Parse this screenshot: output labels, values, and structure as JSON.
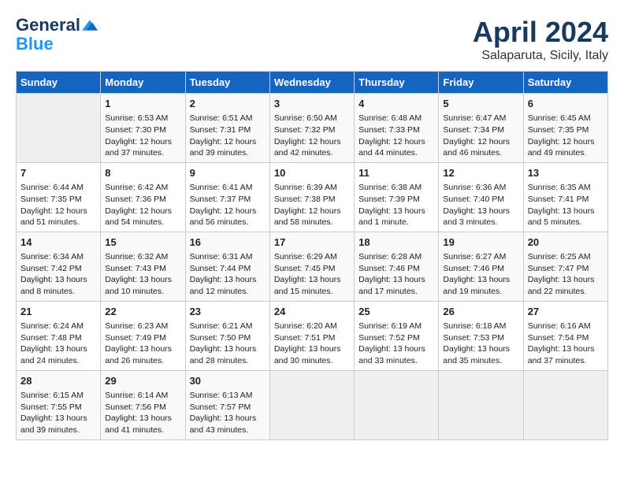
{
  "header": {
    "logo_line1": "General",
    "logo_line2": "Blue",
    "month": "April 2024",
    "location": "Salaparuta, Sicily, Italy"
  },
  "columns": [
    "Sunday",
    "Monday",
    "Tuesday",
    "Wednesday",
    "Thursday",
    "Friday",
    "Saturday"
  ],
  "weeks": [
    [
      {
        "day": "",
        "info": ""
      },
      {
        "day": "1",
        "info": "Sunrise: 6:53 AM\nSunset: 7:30 PM\nDaylight: 12 hours\nand 37 minutes."
      },
      {
        "day": "2",
        "info": "Sunrise: 6:51 AM\nSunset: 7:31 PM\nDaylight: 12 hours\nand 39 minutes."
      },
      {
        "day": "3",
        "info": "Sunrise: 6:50 AM\nSunset: 7:32 PM\nDaylight: 12 hours\nand 42 minutes."
      },
      {
        "day": "4",
        "info": "Sunrise: 6:48 AM\nSunset: 7:33 PM\nDaylight: 12 hours\nand 44 minutes."
      },
      {
        "day": "5",
        "info": "Sunrise: 6:47 AM\nSunset: 7:34 PM\nDaylight: 12 hours\nand 46 minutes."
      },
      {
        "day": "6",
        "info": "Sunrise: 6:45 AM\nSunset: 7:35 PM\nDaylight: 12 hours\nand 49 minutes."
      }
    ],
    [
      {
        "day": "7",
        "info": "Sunrise: 6:44 AM\nSunset: 7:35 PM\nDaylight: 12 hours\nand 51 minutes."
      },
      {
        "day": "8",
        "info": "Sunrise: 6:42 AM\nSunset: 7:36 PM\nDaylight: 12 hours\nand 54 minutes."
      },
      {
        "day": "9",
        "info": "Sunrise: 6:41 AM\nSunset: 7:37 PM\nDaylight: 12 hours\nand 56 minutes."
      },
      {
        "day": "10",
        "info": "Sunrise: 6:39 AM\nSunset: 7:38 PM\nDaylight: 12 hours\nand 58 minutes."
      },
      {
        "day": "11",
        "info": "Sunrise: 6:38 AM\nSunset: 7:39 PM\nDaylight: 13 hours\nand 1 minute."
      },
      {
        "day": "12",
        "info": "Sunrise: 6:36 AM\nSunset: 7:40 PM\nDaylight: 13 hours\nand 3 minutes."
      },
      {
        "day": "13",
        "info": "Sunrise: 6:35 AM\nSunset: 7:41 PM\nDaylight: 13 hours\nand 5 minutes."
      }
    ],
    [
      {
        "day": "14",
        "info": "Sunrise: 6:34 AM\nSunset: 7:42 PM\nDaylight: 13 hours\nand 8 minutes."
      },
      {
        "day": "15",
        "info": "Sunrise: 6:32 AM\nSunset: 7:43 PM\nDaylight: 13 hours\nand 10 minutes."
      },
      {
        "day": "16",
        "info": "Sunrise: 6:31 AM\nSunset: 7:44 PM\nDaylight: 13 hours\nand 12 minutes."
      },
      {
        "day": "17",
        "info": "Sunrise: 6:29 AM\nSunset: 7:45 PM\nDaylight: 13 hours\nand 15 minutes."
      },
      {
        "day": "18",
        "info": "Sunrise: 6:28 AM\nSunset: 7:46 PM\nDaylight: 13 hours\nand 17 minutes."
      },
      {
        "day": "19",
        "info": "Sunrise: 6:27 AM\nSunset: 7:46 PM\nDaylight: 13 hours\nand 19 minutes."
      },
      {
        "day": "20",
        "info": "Sunrise: 6:25 AM\nSunset: 7:47 PM\nDaylight: 13 hours\nand 22 minutes."
      }
    ],
    [
      {
        "day": "21",
        "info": "Sunrise: 6:24 AM\nSunset: 7:48 PM\nDaylight: 13 hours\nand 24 minutes."
      },
      {
        "day": "22",
        "info": "Sunrise: 6:23 AM\nSunset: 7:49 PM\nDaylight: 13 hours\nand 26 minutes."
      },
      {
        "day": "23",
        "info": "Sunrise: 6:21 AM\nSunset: 7:50 PM\nDaylight: 13 hours\nand 28 minutes."
      },
      {
        "day": "24",
        "info": "Sunrise: 6:20 AM\nSunset: 7:51 PM\nDaylight: 13 hours\nand 30 minutes."
      },
      {
        "day": "25",
        "info": "Sunrise: 6:19 AM\nSunset: 7:52 PM\nDaylight: 13 hours\nand 33 minutes."
      },
      {
        "day": "26",
        "info": "Sunrise: 6:18 AM\nSunset: 7:53 PM\nDaylight: 13 hours\nand 35 minutes."
      },
      {
        "day": "27",
        "info": "Sunrise: 6:16 AM\nSunset: 7:54 PM\nDaylight: 13 hours\nand 37 minutes."
      }
    ],
    [
      {
        "day": "28",
        "info": "Sunrise: 6:15 AM\nSunset: 7:55 PM\nDaylight: 13 hours\nand 39 minutes."
      },
      {
        "day": "29",
        "info": "Sunrise: 6:14 AM\nSunset: 7:56 PM\nDaylight: 13 hours\nand 41 minutes."
      },
      {
        "day": "30",
        "info": "Sunrise: 6:13 AM\nSunset: 7:57 PM\nDaylight: 13 hours\nand 43 minutes."
      },
      {
        "day": "",
        "info": ""
      },
      {
        "day": "",
        "info": ""
      },
      {
        "day": "",
        "info": ""
      },
      {
        "day": "",
        "info": ""
      }
    ]
  ]
}
